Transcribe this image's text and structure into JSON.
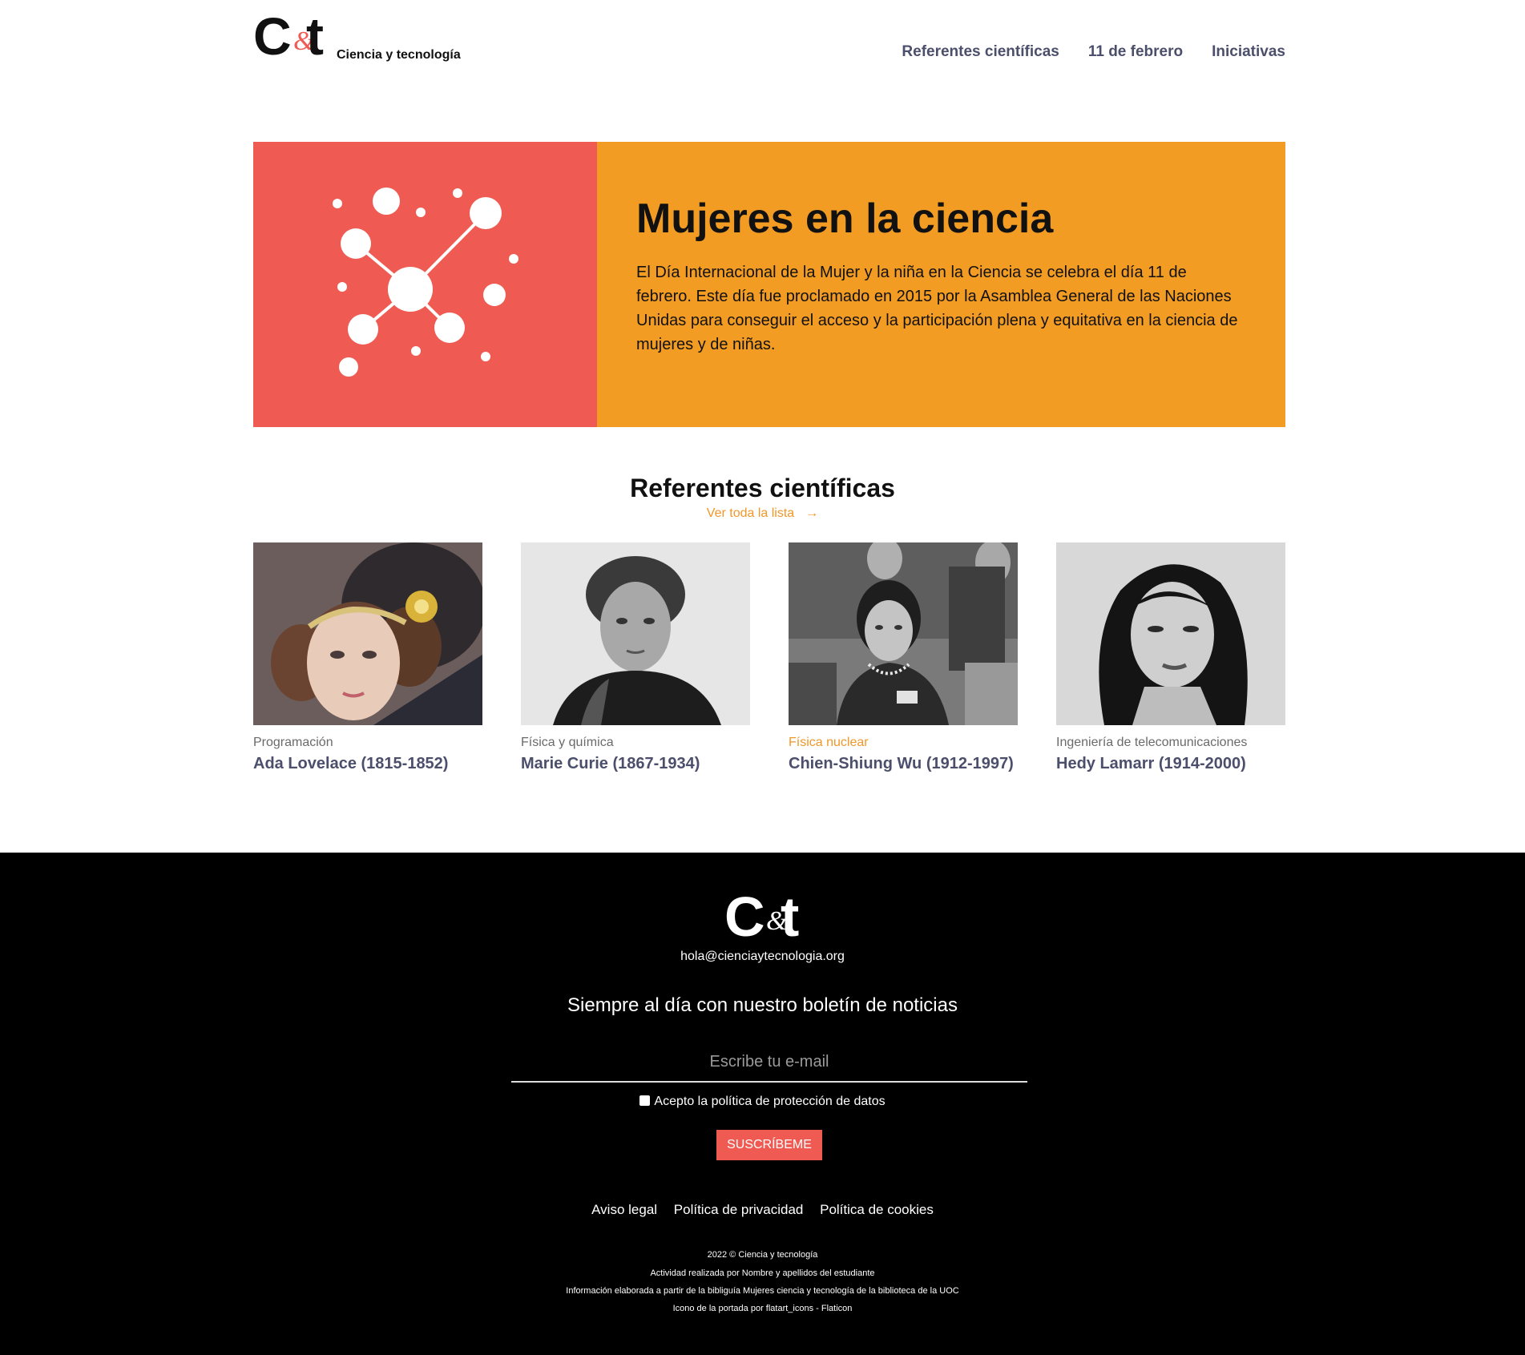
{
  "header": {
    "logo_letters": "C&t",
    "tagline": "Ciencia y tecnología",
    "nav": [
      {
        "label": "Referentes científicas"
      },
      {
        "label": "11 de febrero"
      },
      {
        "label": "Iniciativas"
      }
    ]
  },
  "hero": {
    "title": "Mujeres en la ciencia",
    "text": "El Día Internacional de la Mujer y la niña en la Ciencia se celebra el día 11 de febrero. Este día fue proclamado en 2015 por la Asamblea General de las Naciones Unidas para conseguir el acceso y la participación plena y equitativa en la ciencia de mujeres y de niñas.",
    "left_color": "#ef5b52",
    "right_color": "#f39c24",
    "icon": "molecule-icon"
  },
  "section": {
    "title": "Referentes científicas",
    "see_all": "Ver toda la lista",
    "arrow": "→"
  },
  "cards": [
    {
      "category": "Programación",
      "name": "Ada Lovelace (1815-1852)"
    },
    {
      "category": "Física y química",
      "name": "Marie Curie (1867-1934)"
    },
    {
      "category": "Física nuclear",
      "name": "Chien-Shiung Wu (1912-1997)"
    },
    {
      "category": "Ingeniería de telecomunicaciones",
      "name": "Hedy Lamarr (1914-2000)"
    }
  ],
  "footer": {
    "email": "hola@cienciaytecnologia.org",
    "newsletter_title": "Siempre al día con nuestro boletín de noticias",
    "email_placeholder": "Escribe tu e-mail",
    "consent": "Acepto la política de protección de datos",
    "subscribe": "SUSCRÍBEME",
    "links": [
      {
        "label": "Aviso legal"
      },
      {
        "label": "Política de privacidad"
      },
      {
        "label": "Política de cookies"
      }
    ],
    "copyright": "2022 © Ciencia y tecnología",
    "credit_activity": "Actividad realizada por Nombre y apellidos del estudiante",
    "credit_info": "Información elaborada a partir de la bibliguía Mujeres ciencia y tecnología de la biblioteca de la UOC",
    "credit_icon": "Icono de la portada por flatart_icons - Flaticon"
  },
  "colors": {
    "accent_orange": "#f0972a",
    "coral": "#ef5b52",
    "nav_text": "#4b4f6b"
  }
}
